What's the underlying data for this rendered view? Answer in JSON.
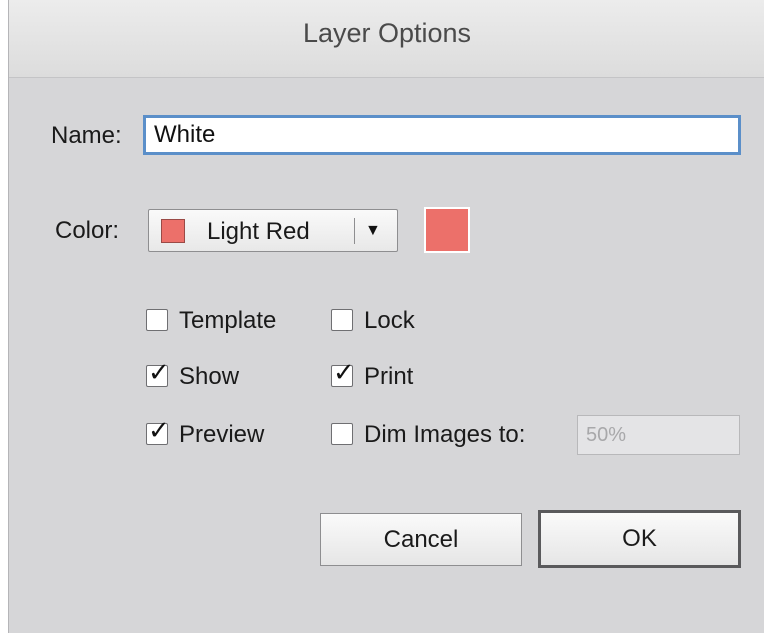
{
  "dialog": {
    "title": "Layer Options"
  },
  "name_field": {
    "label": "Name:",
    "value": "White"
  },
  "color_field": {
    "label": "Color:",
    "selected": "Light Red",
    "swatch_color": "#ec706a",
    "arrow_icon": "triangle-down-icon"
  },
  "options": {
    "template": {
      "label": "Template",
      "checked": false
    },
    "lock": {
      "label": "Lock",
      "checked": false
    },
    "show": {
      "label": "Show",
      "checked": true
    },
    "print": {
      "label": "Print",
      "checked": true
    },
    "preview": {
      "label": "Preview",
      "checked": true
    },
    "dim_images": {
      "label": "Dim Images to:",
      "checked": false,
      "value": "50%"
    }
  },
  "buttons": {
    "cancel": "Cancel",
    "ok": "OK"
  },
  "colors": {
    "focus_ring": "#5b8fc9",
    "dialog_bg": "#d6d6d8"
  }
}
